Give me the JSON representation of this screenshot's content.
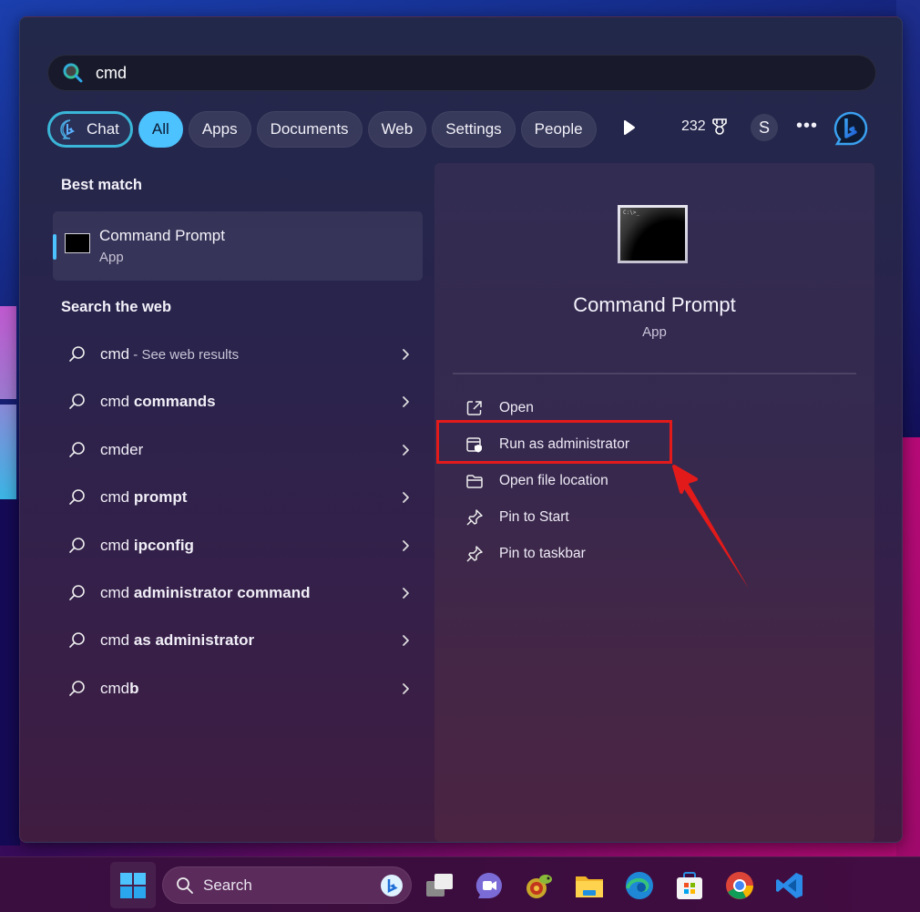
{
  "search": {
    "query": "cmd",
    "placeholder": ""
  },
  "filters": {
    "chat_label": "Chat",
    "tabs": [
      {
        "label": "All",
        "active": true
      },
      {
        "label": "Apps",
        "active": false
      },
      {
        "label": "Documents",
        "active": false
      },
      {
        "label": "Web",
        "active": false
      },
      {
        "label": "Settings",
        "active": false
      },
      {
        "label": "People",
        "active": false
      }
    ],
    "more_results_icon": "play-icon",
    "rewards_points": "232",
    "rewards_icon": "medal-icon",
    "account_initial": "S",
    "more_label": "•••",
    "bing_icon": "bing-icon"
  },
  "best_match": {
    "heading": "Best match",
    "name": "Command Prompt",
    "type": "App"
  },
  "web": {
    "heading": "Search the web",
    "results": [
      {
        "prefix": "cmd",
        "bold": "",
        "suffix": " - See web results"
      },
      {
        "prefix": "cmd ",
        "bold": "commands",
        "suffix": ""
      },
      {
        "prefix": "cmder",
        "bold": "",
        "suffix": ""
      },
      {
        "prefix": "cmd ",
        "bold": "prompt",
        "suffix": ""
      },
      {
        "prefix": "cmd ",
        "bold": "ipconfig",
        "suffix": ""
      },
      {
        "prefix": "cmd ",
        "bold": "administrator command",
        "suffix": ""
      },
      {
        "prefix": "cmd ",
        "bold": "as administrator",
        "suffix": ""
      },
      {
        "prefix": "cmd",
        "bold": "b",
        "suffix": ""
      }
    ]
  },
  "preview": {
    "title": "Command Prompt",
    "type": "App",
    "icon_prompt_text": "C:\\>_",
    "actions": [
      {
        "label": "Open",
        "icon": "open-external-icon"
      },
      {
        "label": "Run as administrator",
        "icon": "shield-window-icon",
        "highlighted": true
      },
      {
        "label": "Open file location",
        "icon": "folder-icon"
      },
      {
        "label": "Pin to Start",
        "icon": "pin-icon"
      },
      {
        "label": "Pin to taskbar",
        "icon": "pin-icon"
      }
    ]
  },
  "annotation": {
    "highlight_color": "#e31a1a",
    "target": "Run as administrator"
  },
  "taskbar": {
    "search_label": "Search",
    "apps": [
      "task-view",
      "teams-meet",
      "chameleon-app",
      "file-explorer",
      "edge",
      "microsoft-store",
      "chrome",
      "vscode"
    ]
  },
  "colors": {
    "accent": "#4cc2ff",
    "chat_border": "#3ab6d8"
  }
}
